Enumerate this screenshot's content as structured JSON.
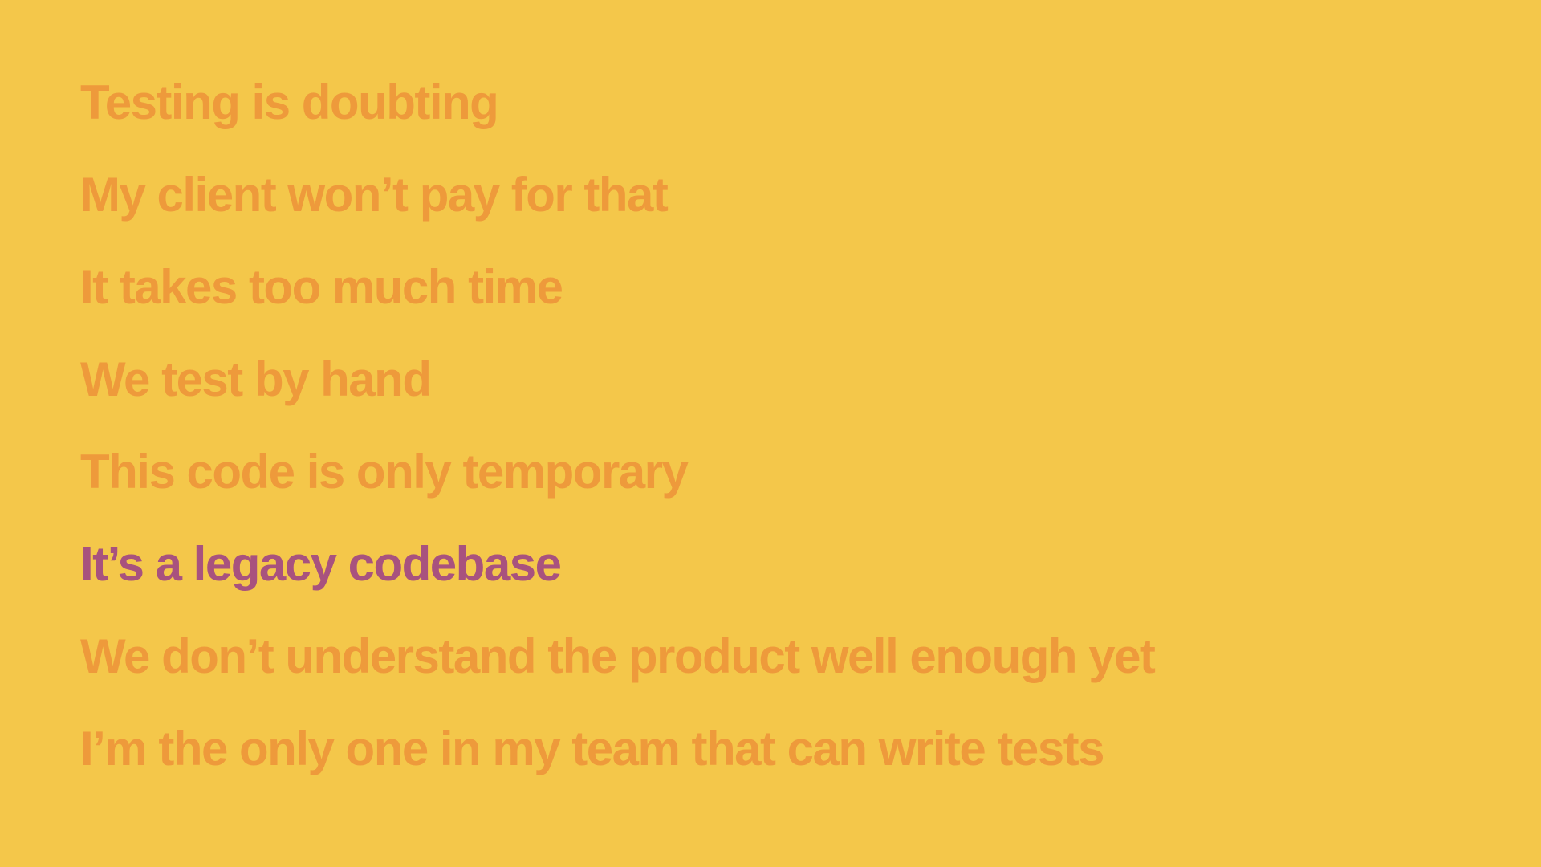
{
  "colors": {
    "background": "#F4C74A",
    "text": "#EE9A3B",
    "highlight": "#A8527E"
  },
  "slide": {
    "lines": [
      {
        "text": "Testing is doubting",
        "highlighted": false
      },
      {
        "text": "My client won’t pay for that",
        "highlighted": false
      },
      {
        "text": "It takes too much time",
        "highlighted": false
      },
      {
        "text": "We test by hand",
        "highlighted": false
      },
      {
        "text": "This code is only temporary",
        "highlighted": false
      },
      {
        "text": "It’s a legacy codebase",
        "highlighted": true
      },
      {
        "text": "We don’t understand the product well enough yet",
        "highlighted": false
      },
      {
        "text": "I’m the only one in my team that can write tests",
        "highlighted": false
      }
    ]
  }
}
